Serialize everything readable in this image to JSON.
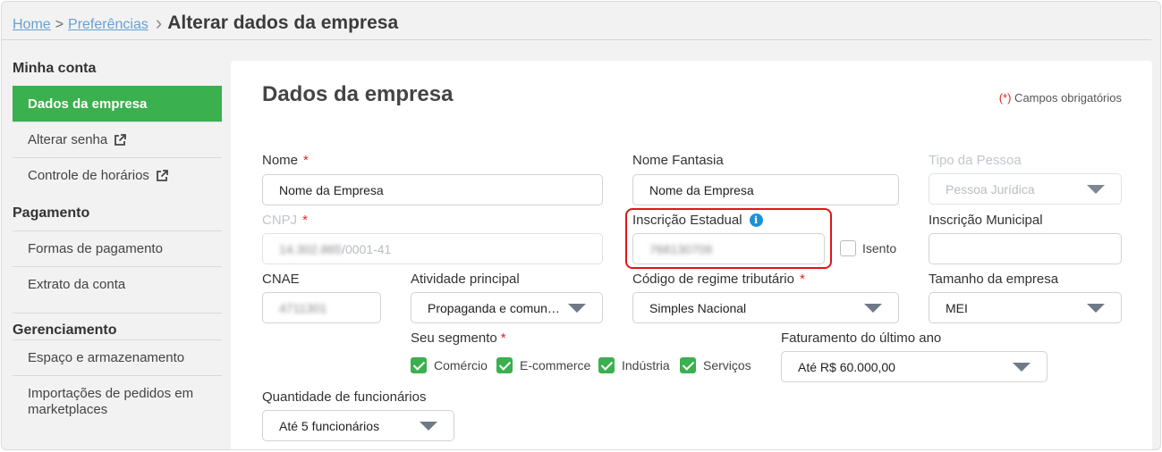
{
  "breadcrumb": {
    "home": "Home",
    "separator": ">",
    "preferences": "Preferências",
    "current": "Alterar dados da empresa"
  },
  "sidebar": {
    "sections": [
      {
        "title": "Minha conta",
        "items": [
          {
            "label": "Dados da empresa",
            "active": true,
            "external": false
          },
          {
            "label": "Alterar senha",
            "active": false,
            "external": true
          },
          {
            "label": "Controle de horários",
            "active": false,
            "external": true
          }
        ]
      },
      {
        "title": "Pagamento",
        "items": [
          {
            "label": "Formas de pagamento",
            "active": false,
            "external": false
          },
          {
            "label": "Extrato da conta",
            "active": false,
            "external": false
          }
        ]
      },
      {
        "title": "Gerenciamento",
        "items": [
          {
            "label": "Espaço e armazenamento",
            "active": false,
            "external": false
          },
          {
            "label": "Importações de pedidos em marketplaces",
            "active": false,
            "external": false
          }
        ]
      }
    ]
  },
  "panel": {
    "title": "Dados da empresa",
    "required_star": "(*)",
    "required_note": " Campos obrigatórios"
  },
  "form": {
    "nome": {
      "label": "Nome",
      "required": "*",
      "value": "Nome da Empresa"
    },
    "nome_fantasia": {
      "label": "Nome Fantasia",
      "value": "Nome da Empresa"
    },
    "tipo_pessoa": {
      "label": "Tipo da Pessoa",
      "value": "Pessoa Jurídica"
    },
    "cnpj": {
      "label": "CNPJ",
      "required": "*",
      "value_hidden": "14.302.865",
      "value_visible": "/0001-41"
    },
    "inscricao_estadual": {
      "label": "Inscrição Estadual",
      "info_icon": "info-icon",
      "value": "768130709"
    },
    "isento": {
      "label": "Isento",
      "checked": false
    },
    "inscricao_municipal": {
      "label": "Inscrição Municipal",
      "value": ""
    },
    "cnae": {
      "label": "CNAE",
      "value": "4711301"
    },
    "atividade_principal": {
      "label": "Atividade principal",
      "value": "Propaganda e comunicação"
    },
    "regime_tributario": {
      "label": "Código de regime tributário",
      "required": "*",
      "value": "Simples Nacional"
    },
    "tamanho_empresa": {
      "label": "Tamanho da empresa",
      "value": "MEI"
    },
    "segmento": {
      "label": "Seu segmento",
      "required": "*",
      "options": [
        {
          "label": "Comércio",
          "checked": true
        },
        {
          "label": "E-commerce",
          "checked": true
        },
        {
          "label": "Indústria",
          "checked": true
        },
        {
          "label": "Serviços",
          "checked": true
        }
      ]
    },
    "faturamento": {
      "label": "Faturamento do último ano",
      "value": "Até R$ 60.000,00"
    },
    "funcionarios": {
      "label": "Quantidade de funcionários",
      "value": "Até 5 funcionários"
    }
  },
  "colors": {
    "accent_green": "#3bb04f",
    "required_red": "#e0271f",
    "highlight_red": "#e0141b",
    "link_blue": "#6a9fcf",
    "info_blue": "#1e90d6"
  }
}
